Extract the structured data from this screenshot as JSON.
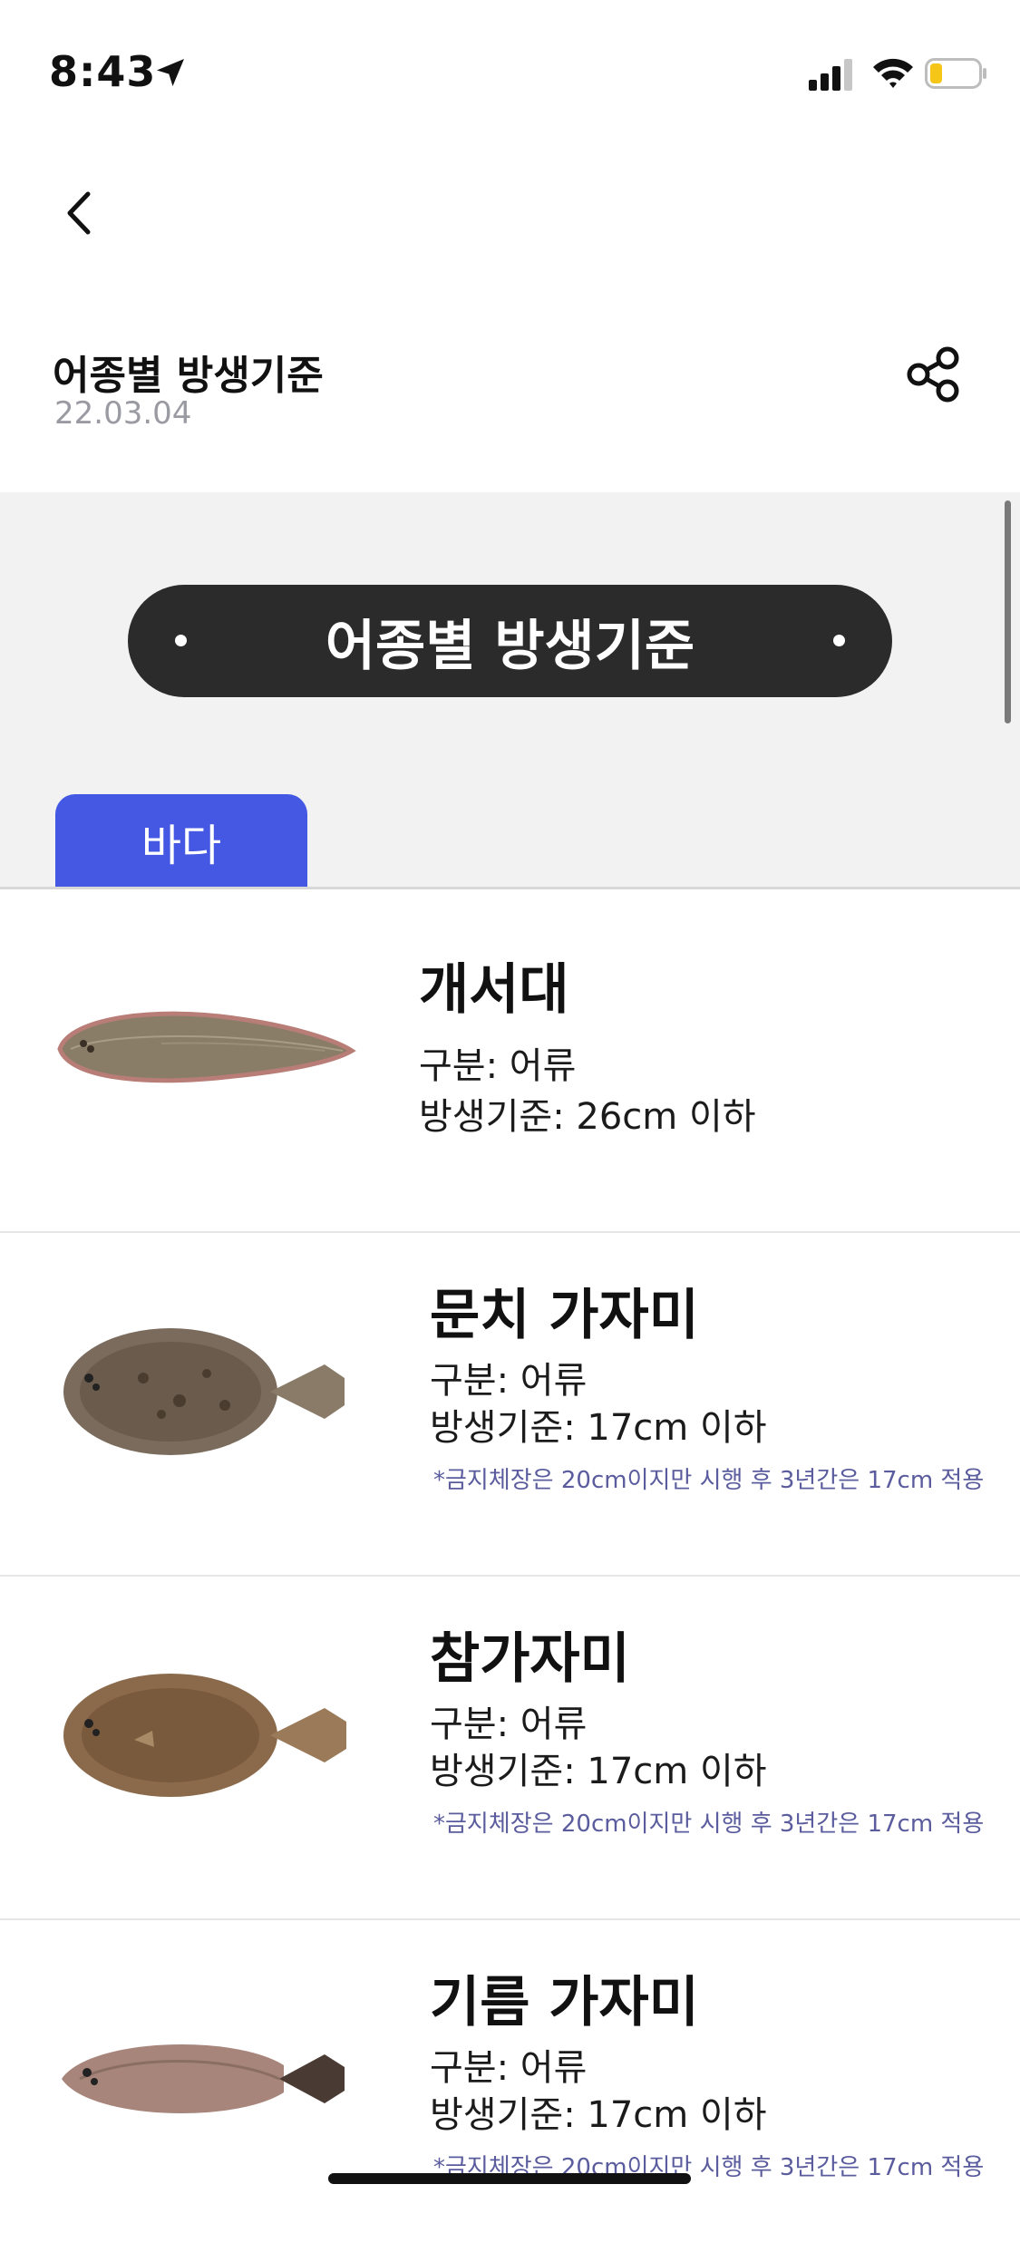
{
  "status_bar": {
    "time": "8:43"
  },
  "header": {
    "title": "어종별 방생기준",
    "date": "22.03.04"
  },
  "banner": {
    "title": "어종별 방생기준"
  },
  "tabs": [
    {
      "label": "바다",
      "active": true
    }
  ],
  "fish": [
    {
      "name": "개서대",
      "category": "구분: 어류",
      "standard": "방생기준: 26cm 이하",
      "note": ""
    },
    {
      "name": "문치 가자미",
      "category": "구분: 어류",
      "standard": "방생기준: 17cm 이하",
      "note": "*금지체장은 20cm이지만 시행 후 3년간은 17cm 적용"
    },
    {
      "name": "참가자미",
      "category": "구분: 어류",
      "standard": "방생기준: 17cm 이하",
      "note": "*금지체장은 20cm이지만 시행 후 3년간은 17cm 적용"
    },
    {
      "name": "기름 가자미",
      "category": "구분: 어류",
      "standard": "방생기준: 17cm 이하",
      "note": "*금지체장은 20cm이지만 시행 후 3년간은 17cm 적용"
    }
  ],
  "colors": {
    "accent": "#4458e3",
    "pill": "#2b2b2b",
    "note": "#5a5c9e",
    "date": "#9a9aa2"
  }
}
